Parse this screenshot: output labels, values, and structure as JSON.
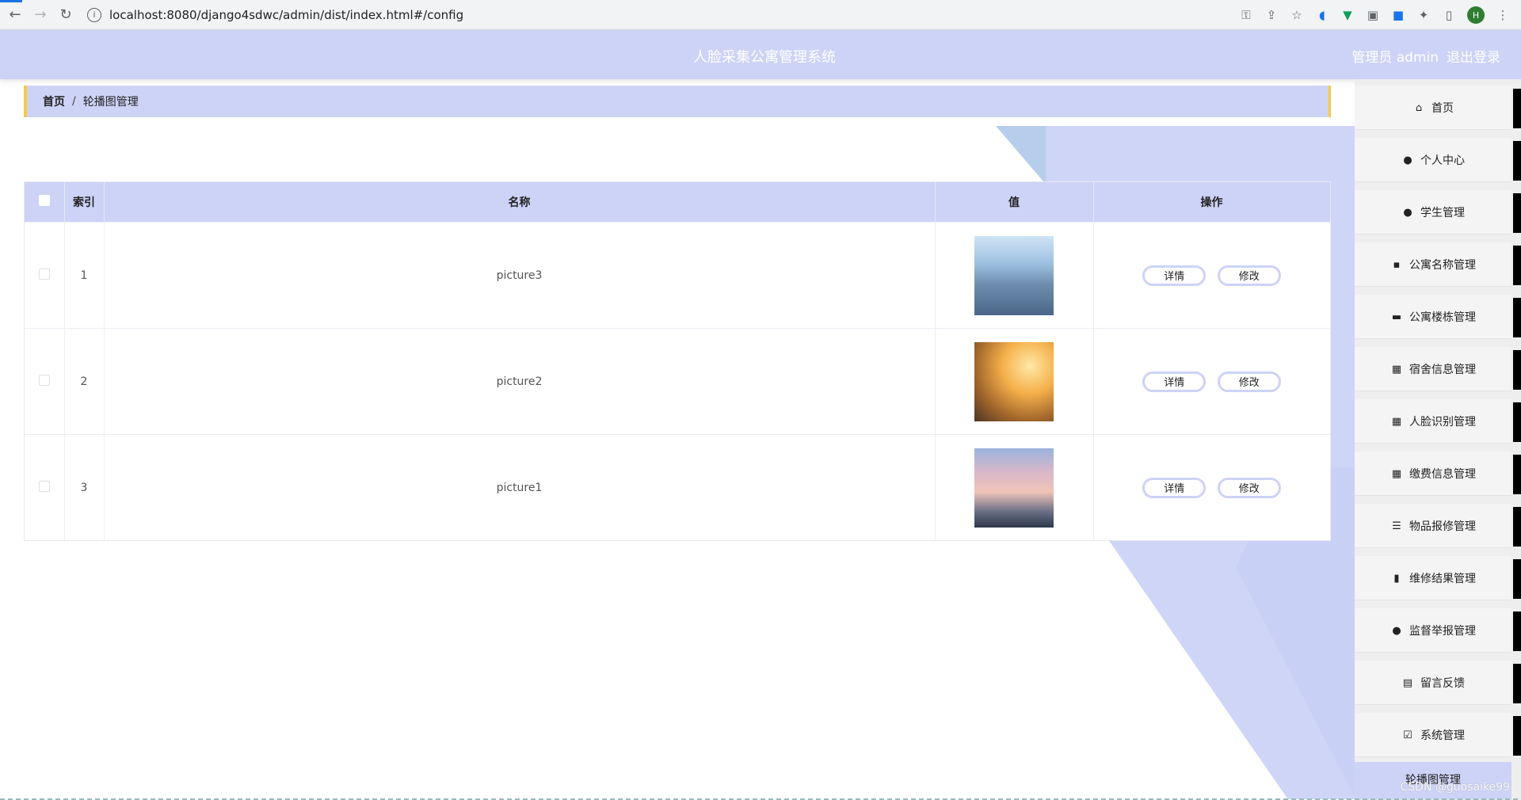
{
  "browser": {
    "url": "localhost:8080/django4sdwc/admin/dist/index.html#/config",
    "profile_initial": "H"
  },
  "header": {
    "title": "人脸采集公寓管理系统",
    "user_label": "管理员 admin",
    "logout_label": "退出登录"
  },
  "breadcrumb": {
    "home": "首页",
    "separator": "/",
    "current": "轮播图管理"
  },
  "table": {
    "columns": [
      "索引",
      "名称",
      "值",
      "操作"
    ],
    "rows": [
      {
        "index": "1",
        "name": "picture3",
        "detail_label": "详情",
        "edit_label": "修改"
      },
      {
        "index": "2",
        "name": "picture2",
        "detail_label": "详情",
        "edit_label": "修改"
      },
      {
        "index": "3",
        "name": "picture1",
        "detail_label": "详情",
        "edit_label": "修改"
      }
    ]
  },
  "sidebar": {
    "items": [
      {
        "label": "首页",
        "icon": "home-icon"
      },
      {
        "label": "个人中心",
        "icon": "user-icon"
      },
      {
        "label": "学生管理",
        "icon": "user-icon"
      },
      {
        "label": "公寓名称管理",
        "icon": "chat-icon"
      },
      {
        "label": "公寓楼栋管理",
        "icon": "briefcase-icon"
      },
      {
        "label": "宿舍信息管理",
        "icon": "grid-icon"
      },
      {
        "label": "人脸识别管理",
        "icon": "grid-icon"
      },
      {
        "label": "缴费信息管理",
        "icon": "grid-icon"
      },
      {
        "label": "物品报修管理",
        "icon": "sliders-icon"
      },
      {
        "label": "维修结果管理",
        "icon": "book-icon"
      },
      {
        "label": "监督举报管理",
        "icon": "pin-icon"
      },
      {
        "label": "留言反馈",
        "icon": "clipboard-icon"
      },
      {
        "label": "系统管理",
        "icon": "clipboard-check-icon"
      },
      {
        "label": "轮播图管理",
        "icon": ""
      }
    ]
  },
  "watermark": "CSDN @guosaike99",
  "colors": {
    "accent": "#cdd3f6",
    "breadcrumb_border": "#f5c94e"
  }
}
